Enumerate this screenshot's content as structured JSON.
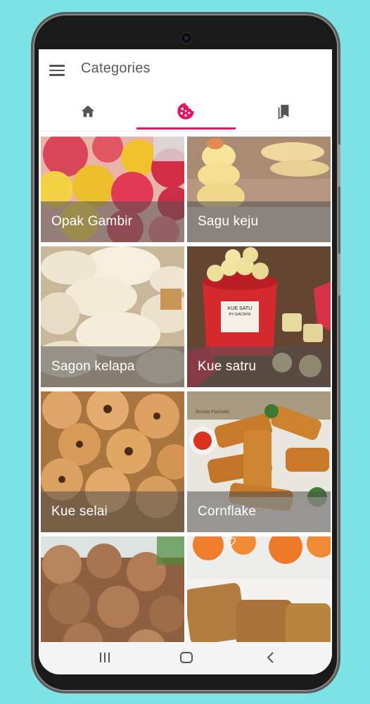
{
  "app": {
    "title": "Categories"
  },
  "tabs": [
    {
      "name": "home",
      "icon": "home-icon",
      "active": false
    },
    {
      "name": "categories",
      "icon": "cookie-icon",
      "active": true
    },
    {
      "name": "bookmarks",
      "icon": "bookmarks-icon",
      "active": false
    }
  ],
  "categories": [
    {
      "label": "Opak Gambir"
    },
    {
      "label": "Sagu keju"
    },
    {
      "label": "Sagon kelapa"
    },
    {
      "label": "Kue satru"
    },
    {
      "label": "Kue selai"
    },
    {
      "label": "Cornflake"
    },
    {
      "label": ""
    },
    {
      "label": ""
    }
  ],
  "photo_text": {
    "bucket_line1": "KUE SATU",
    "bucket_line2": "BY GIACINTA",
    "watermark": "Bunda Pashafa"
  },
  "colors": {
    "accent": "#e0186b",
    "icon_gray": "#555555",
    "label_overlay": "rgba(80,80,80,0.55)",
    "background": "#7ee3e7"
  },
  "system_nav": [
    {
      "name": "recents",
      "icon": "recents-icon"
    },
    {
      "name": "home",
      "icon": "home-circle-icon"
    },
    {
      "name": "back",
      "icon": "back-icon"
    }
  ]
}
